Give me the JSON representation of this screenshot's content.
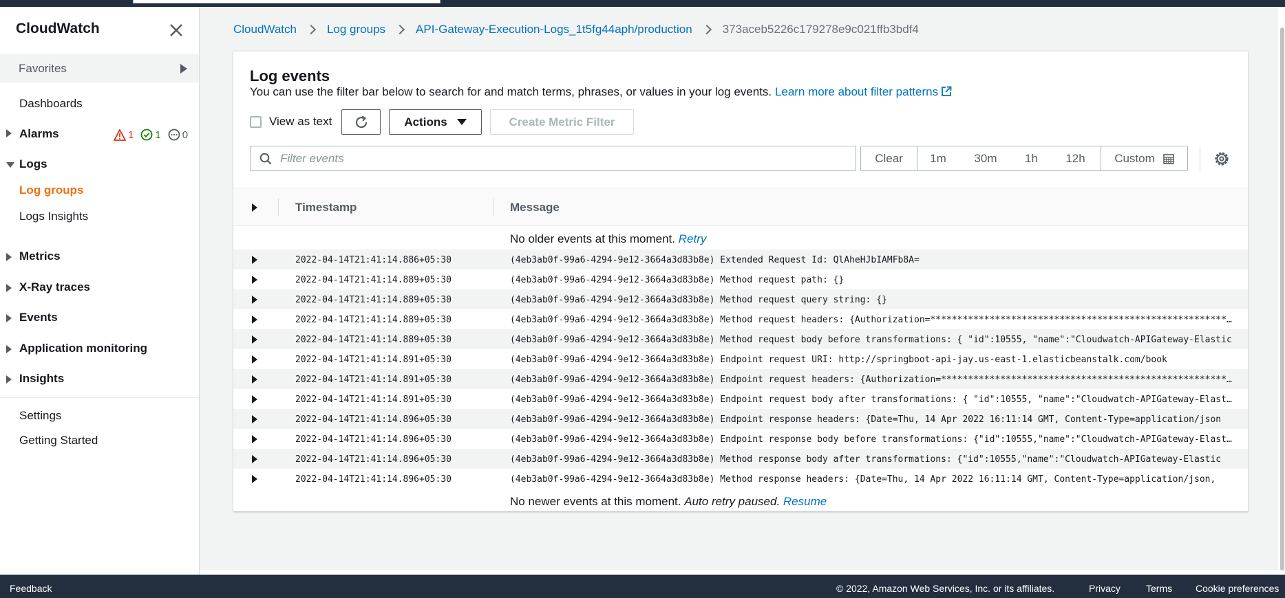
{
  "app": {
    "title": "CloudWatch"
  },
  "sidebar": {
    "favorites": "Favorites",
    "dashboards": "Dashboards",
    "alarms": {
      "label": "Alarms",
      "in_alarm": "1",
      "ok": "1",
      "insufficient": "0"
    },
    "logs": "Logs",
    "log_groups": "Log groups",
    "logs_insights": "Logs Insights",
    "metrics": "Metrics",
    "xray": "X-Ray traces",
    "events": "Events",
    "app_monitoring": "Application monitoring",
    "insights": "Insights",
    "settings": "Settings",
    "getting_started": "Getting Started"
  },
  "breadcrumb": {
    "items": [
      "CloudWatch",
      "Log groups",
      "API-Gateway-Execution-Logs_1t5fg44aph/production"
    ],
    "current": "373aceb5226c179278e9c021ffb3bdf4"
  },
  "panel": {
    "title": "Log events",
    "description": "You can use the filter bar below to search for and match terms, phrases, or values in your log events.",
    "learn_more": "Learn more about filter patterns",
    "view_as_text": "View as text",
    "actions": "Actions",
    "create_metric_filter": "Create Metric Filter",
    "filter_placeholder": "Filter events",
    "time": {
      "clear": "Clear",
      "r1": "1m",
      "r2": "30m",
      "r3": "1h",
      "r4": "12h",
      "custom": "Custom"
    }
  },
  "table": {
    "col_timestamp": "Timestamp",
    "col_message": "Message",
    "top_notice": "No older events at this moment.",
    "top_action": "Retry",
    "bottom_notice": "No newer events at this moment.",
    "bottom_paused": "Auto retry paused.",
    "bottom_action": "Resume",
    "rows": [
      {
        "ts": "2022-04-14T21:41:14.886+05:30",
        "msg": "(4eb3ab0f-99a6-4294-9e12-3664a3d83b8e) Extended Request Id: QlAheHJbIAMFb8A="
      },
      {
        "ts": "2022-04-14T21:41:14.889+05:30",
        "msg": "(4eb3ab0f-99a6-4294-9e12-3664a3d83b8e) Method request path: {}"
      },
      {
        "ts": "2022-04-14T21:41:14.889+05:30",
        "msg": "(4eb3ab0f-99a6-4294-9e12-3664a3d83b8e) Method request query string: {}"
      },
      {
        "ts": "2022-04-14T21:41:14.889+05:30",
        "msg": "(4eb3ab0f-99a6-4294-9e12-3664a3d83b8e) Method request headers: {Authorization=****************************************************************"
      },
      {
        "ts": "2022-04-14T21:41:14.889+05:30",
        "msg": "(4eb3ab0f-99a6-4294-9e12-3664a3d83b8e) Method request body before transformations: { \"id\":10555, \"name\":\"Cloudwatch-APIGateway-Elastic"
      },
      {
        "ts": "2022-04-14T21:41:14.891+05:30",
        "msg": "(4eb3ab0f-99a6-4294-9e12-3664a3d83b8e) Endpoint request URI: http://springboot-api-jay.us-east-1.elasticbeanstalk.com/book"
      },
      {
        "ts": "2022-04-14T21:41:14.891+05:30",
        "msg": "(4eb3ab0f-99a6-4294-9e12-3664a3d83b8e) Endpoint request headers: {Authorization=****************************************************************"
      },
      {
        "ts": "2022-04-14T21:41:14.891+05:30",
        "msg": "(4eb3ab0f-99a6-4294-9e12-3664a3d83b8e) Endpoint request body after transformations: { \"id\":10555, \"name\":\"Cloudwatch-APIGateway-Elastic"
      },
      {
        "ts": "2022-04-14T21:41:14.896+05:30",
        "msg": "(4eb3ab0f-99a6-4294-9e12-3664a3d83b8e) Endpoint response headers: {Date=Thu, 14 Apr 2022 16:11:14 GMT, Content-Type=application/json"
      },
      {
        "ts": "2022-04-14T21:41:14.896+05:30",
        "msg": "(4eb3ab0f-99a6-4294-9e12-3664a3d83b8e) Endpoint response body before transformations: {\"id\":10555,\"name\":\"Cloudwatch-APIGateway-Elastic"
      },
      {
        "ts": "2022-04-14T21:41:14.896+05:30",
        "msg": "(4eb3ab0f-99a6-4294-9e12-3664a3d83b8e) Method response body after transformations: {\"id\":10555,\"name\":\"Cloudwatch-APIGateway-Elastic"
      },
      {
        "ts": "2022-04-14T21:41:14.896+05:30",
        "msg": "(4eb3ab0f-99a6-4294-9e12-3664a3d83b8e) Method response headers: {Date=Thu, 14 Apr 2022 16:11:14 GMT, Content-Type=application/json, "
      }
    ]
  },
  "footer": {
    "feedback": "Feedback",
    "copyright": "© 2022, Amazon Web Services, Inc. or its affiliates.",
    "privacy": "Privacy",
    "terms": "Terms",
    "cookies": "Cookie preferences"
  },
  "colors": {
    "link": "#0073bb",
    "active": "#ec7211",
    "dark": "#232f3e",
    "alarm": "#d13212",
    "ok": "#1d8102"
  }
}
